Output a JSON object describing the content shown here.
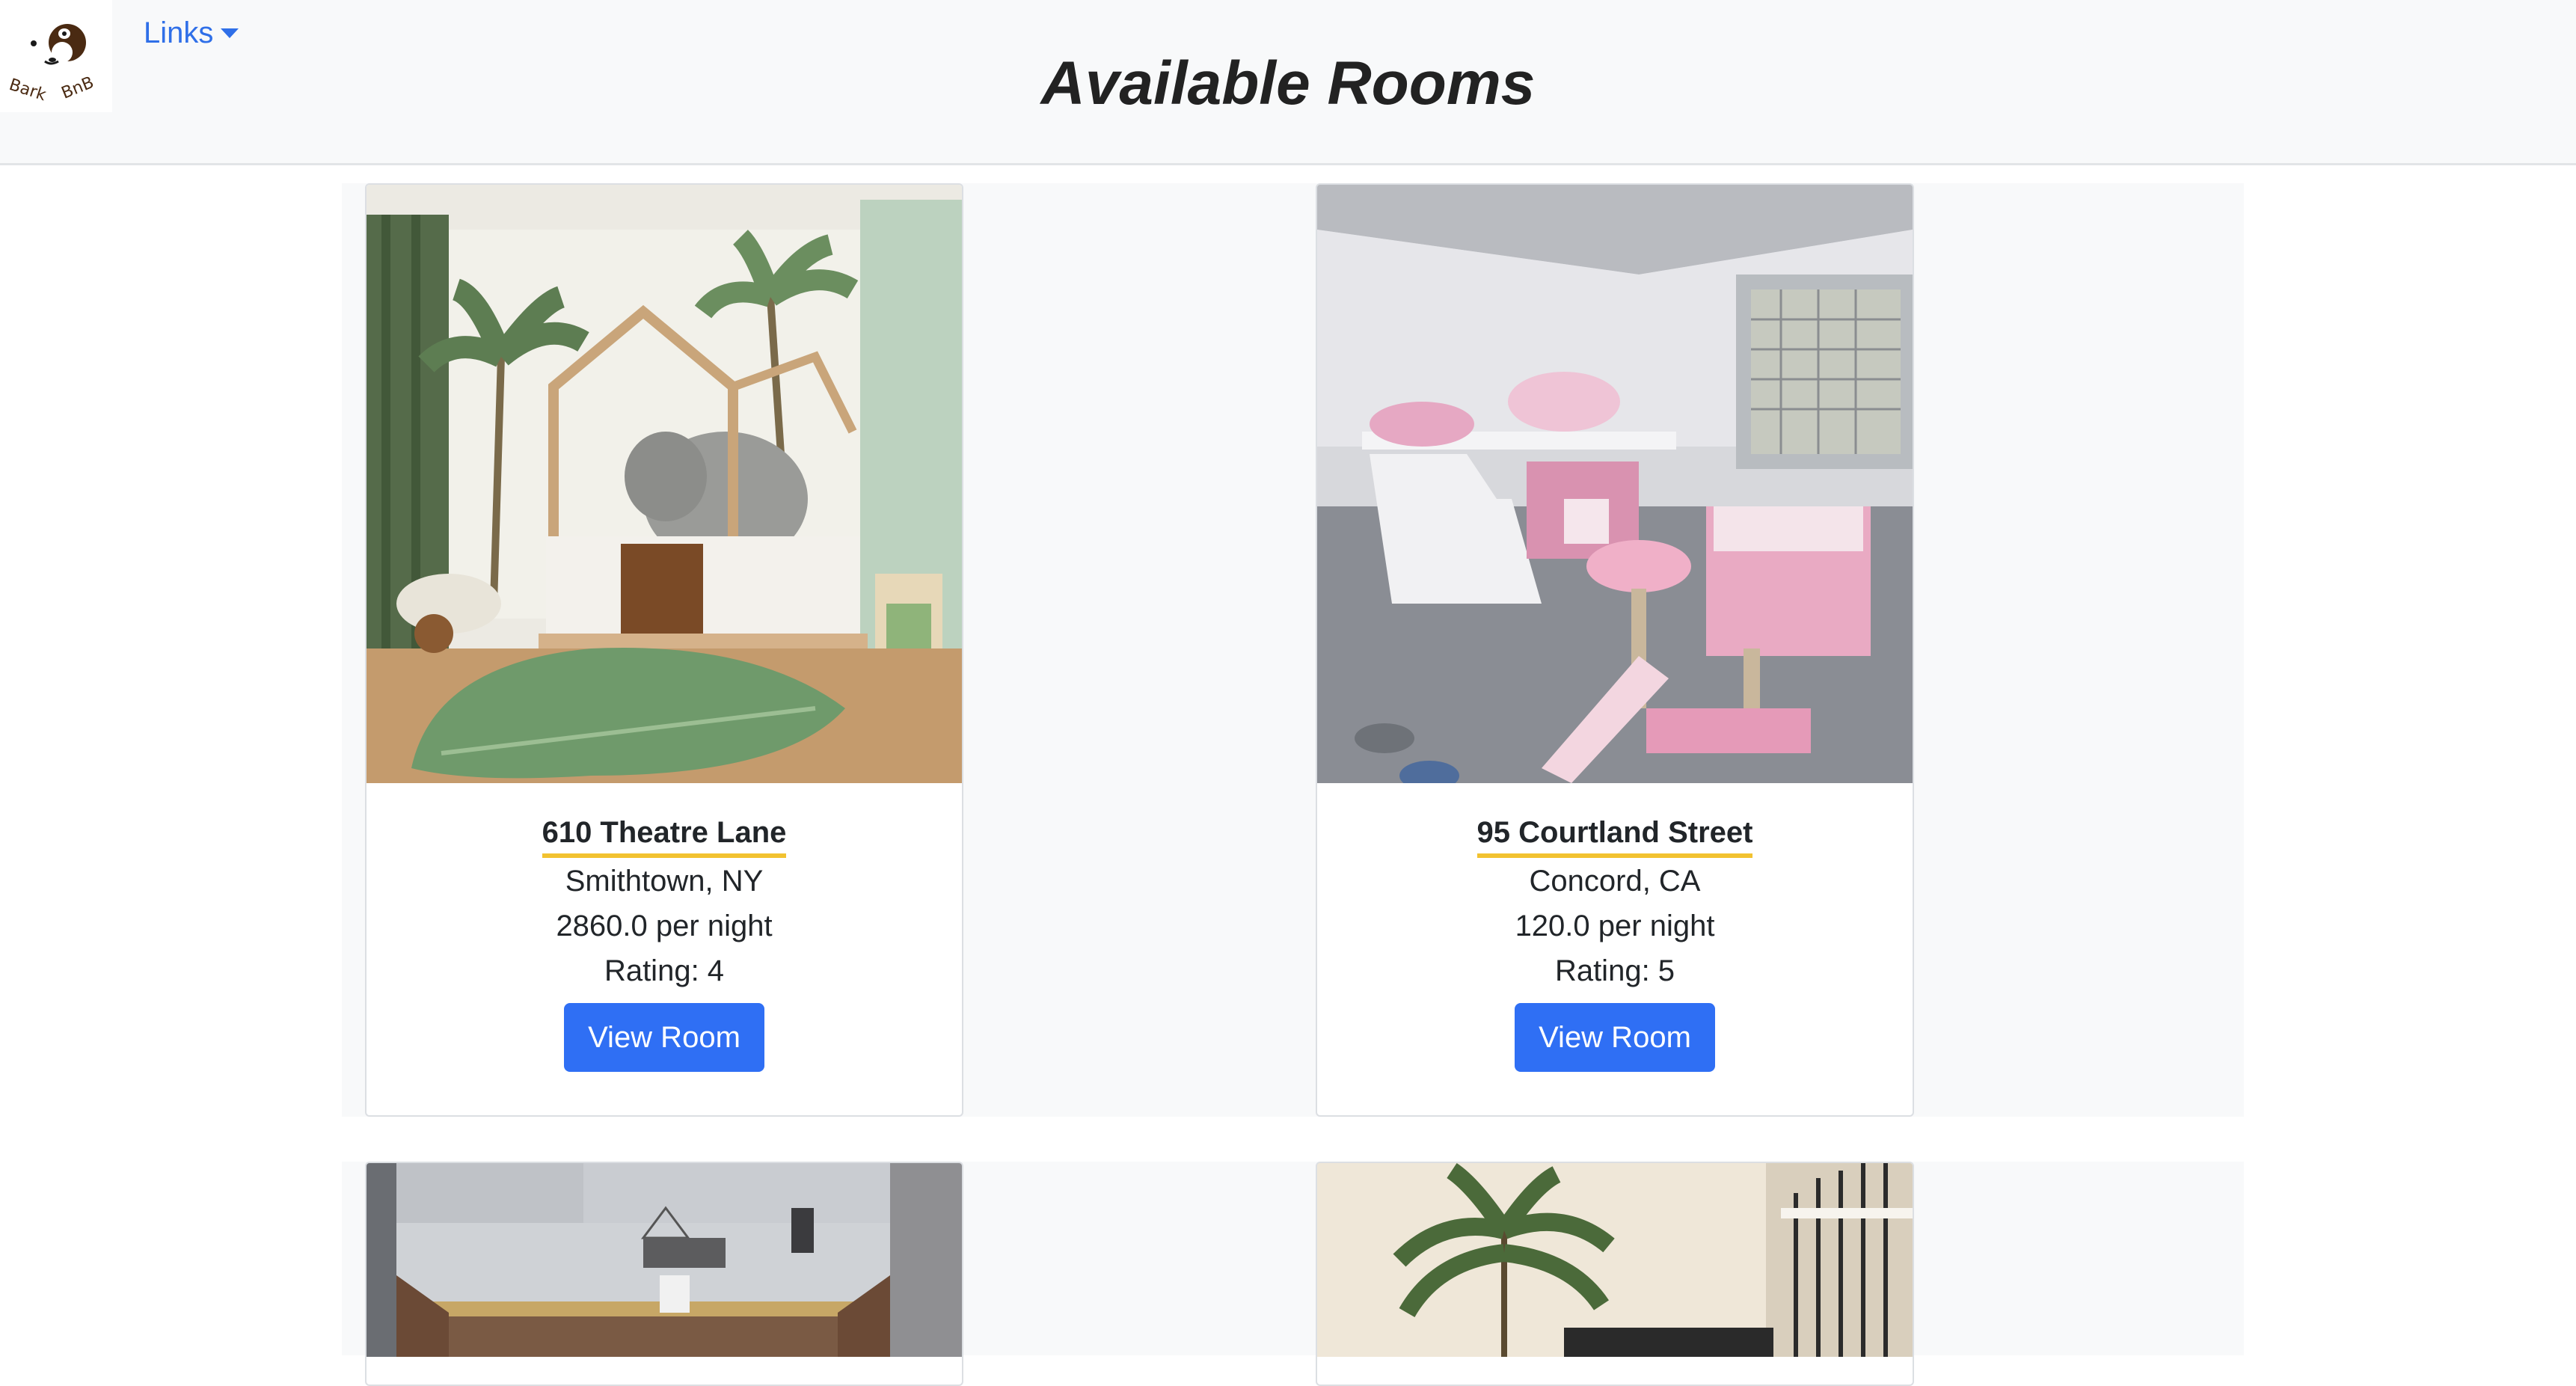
{
  "brand": {
    "logo_text": "Bark BnB",
    "links_label": "Links"
  },
  "page": {
    "title": "Available Rooms"
  },
  "colors": {
    "accent": "#2f6ff4",
    "link": "#2f6fe8",
    "underline": "#f2c230",
    "navbar_bg": "#f8f9fa"
  },
  "rooms": [
    {
      "address": "610 Theatre Lane",
      "location": "Smithtown, NY",
      "price": "2860.0 per night",
      "rating": "Rating: 4",
      "button": "View Room"
    },
    {
      "address": "95 Courtland Street",
      "location": "Concord, CA",
      "price": "120.0 per night",
      "rating": "Rating: 5",
      "button": "View Room"
    },
    {},
    {}
  ]
}
